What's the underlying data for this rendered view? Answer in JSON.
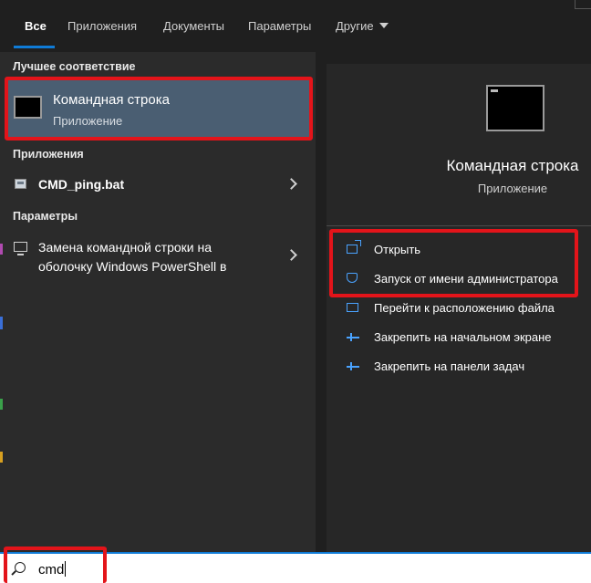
{
  "tabs": {
    "all": "Все",
    "apps": "Приложения",
    "documents": "Документы",
    "settings": "Параметры",
    "other": "Другие"
  },
  "left": {
    "best_match_title": "Лучшее соответствие",
    "best_match": {
      "name": "Командная строка",
      "type": "Приложение"
    },
    "apps_title": "Приложения",
    "apps_item": "CMD_ping.bat",
    "settings_title": "Параметры",
    "settings_item_line1": "Замена командной строки на",
    "settings_item_line2": "оболочку Windows PowerShell в"
  },
  "right": {
    "app_title": "Командная строка",
    "app_type": "Приложение",
    "actions": [
      {
        "label": "Открыть",
        "icon": "open-icon"
      },
      {
        "label": "Запуск от имени администратора",
        "icon": "shield-icon"
      },
      {
        "label": "Перейти к расположению файла",
        "icon": "folder-icon"
      },
      {
        "label": "Закрепить на начальном экране",
        "icon": "pin-icon"
      },
      {
        "label": "Закрепить на панели задач",
        "icon": "pin-icon"
      }
    ]
  },
  "search": {
    "value": "cmd"
  },
  "colors": {
    "accent": "#0f7bd6",
    "selected": "#4a5e72",
    "highlight": "#e3141a"
  }
}
